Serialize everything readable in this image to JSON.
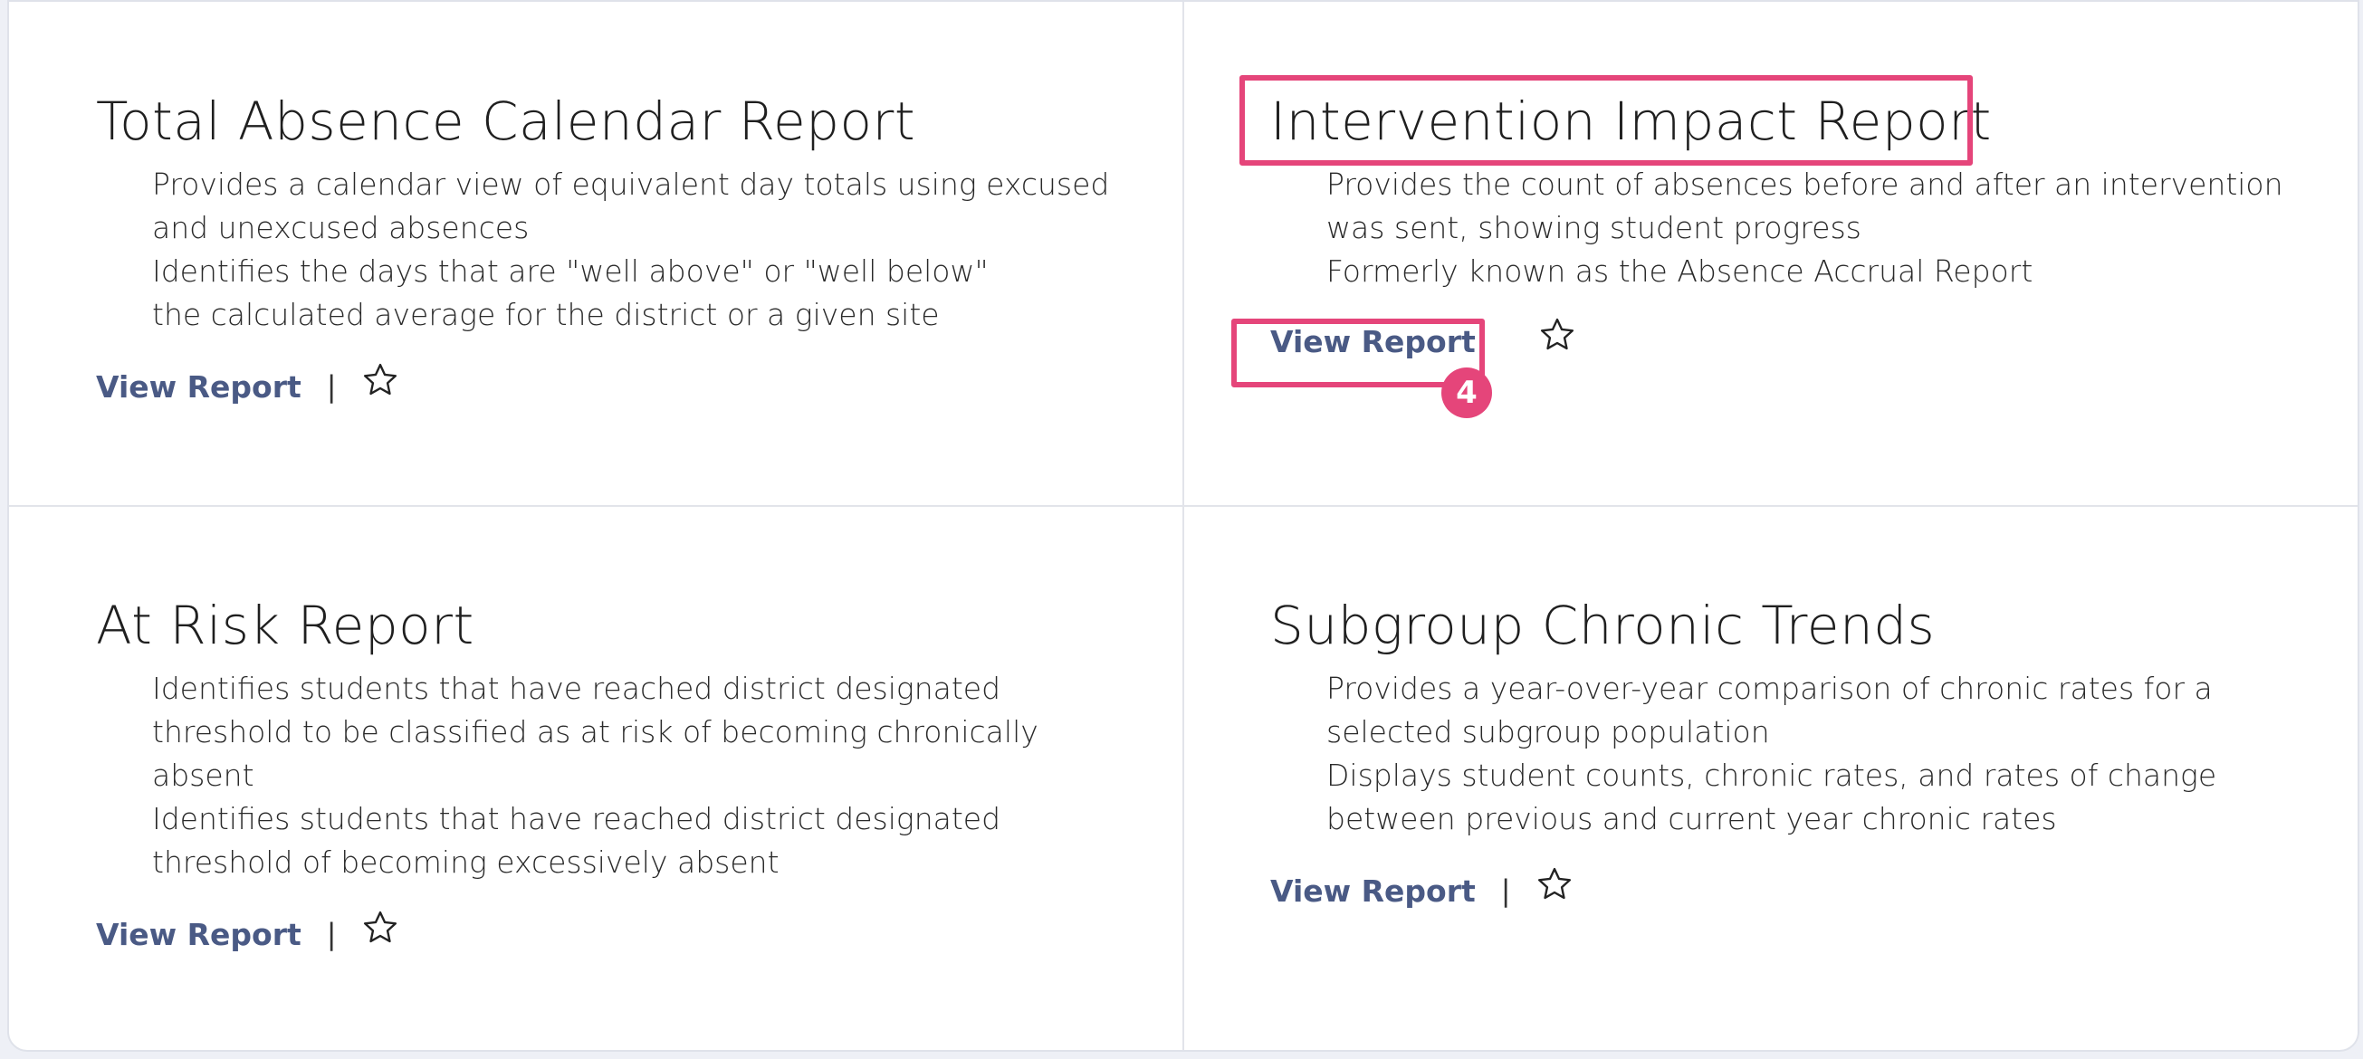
{
  "cards": [
    {
      "title": "Total Absence Calendar Report",
      "desc": [
        "Provides a calendar view of equivalent day totals using excused and unexcused absences",
        "Identifies the days that are \"well above\" or \"well below\" the calculated average for the district or a given site"
      ],
      "view_label": "View Report",
      "separator": "|"
    },
    {
      "title": "Intervention Impact Report",
      "desc": [
        "Provides the count of absences before and after an intervention was sent, showing student progress",
        "Formerly known as the Absence Accrual Report"
      ],
      "view_label": "View Report",
      "separator": ""
    },
    {
      "title": "At Risk Report",
      "desc": [
        "Identifies students that have reached district designated threshold to be classified as at risk of becoming chronically absent",
        "Identifies students that have reached district designated threshold of becoming excessively absent"
      ],
      "view_label": "View Report",
      "separator": "|"
    },
    {
      "title": "Subgroup Chronic Trends",
      "desc": [
        "Provides a year-over-year comparison of chronic rates for a selected subgroup population",
        "Displays student counts, chronic rates, and rates of change between previous and current year chronic rates"
      ],
      "view_label": "View Report",
      "separator": "|"
    }
  ],
  "annotation": {
    "badge_number": "4",
    "color": "#e5457a"
  },
  "colors": {
    "link": "#4a5a85",
    "divider": "#e2e4ea"
  }
}
